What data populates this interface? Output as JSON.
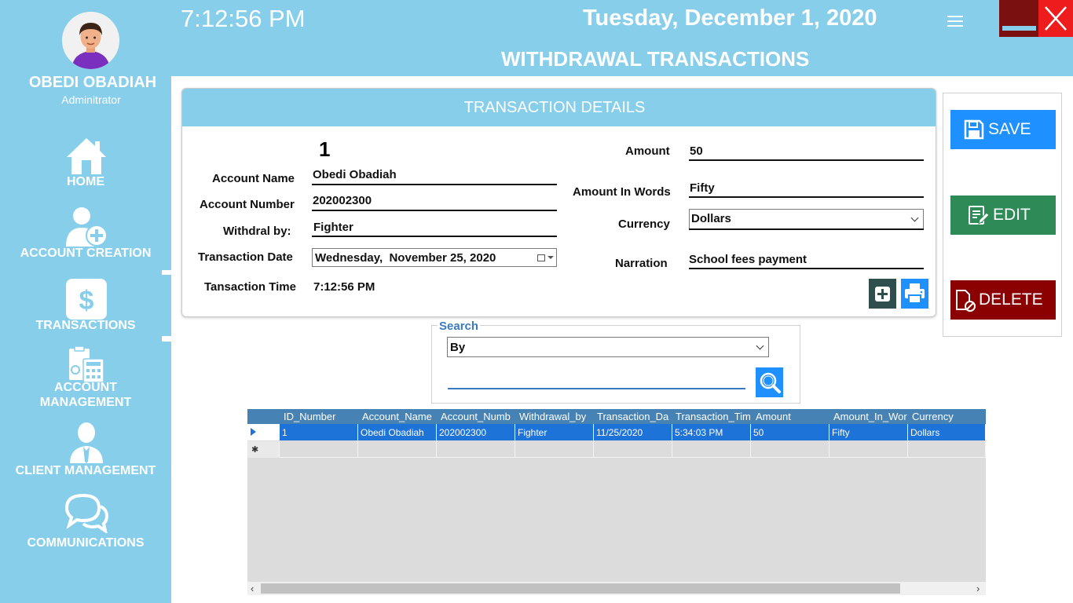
{
  "user": {
    "name": "OBEDI OBADIAH",
    "role": "Admin​itrator"
  },
  "nav": [
    {
      "label": "HOME",
      "icon": "home-icon"
    },
    {
      "label": "ACCOUNT CREATION",
      "icon": "add-user-icon"
    },
    {
      "label": "TRANSACTIONS",
      "icon": "dollar-icon"
    },
    {
      "label": "ACCOUNT MANAGEMENT",
      "label_line1": "ACCOUNT",
      "label_line2": "MANAGEMENT",
      "icon": "calculator-icon"
    },
    {
      "label": "CLIENT MANAGEMENT",
      "icon": "client-icon"
    },
    {
      "label": "COMMUNICATIONS",
      "icon": "chat-icon"
    }
  ],
  "header": {
    "time": "7:12:56 PM",
    "date": "Tuesday, December 1, 2020",
    "page_title": "WITHDRAWAL TRANSACTIONS"
  },
  "details": {
    "title": "TRANSACTION DETAILS",
    "id_number": "1",
    "account_name_label": "Account Name",
    "account_name": "Obedi Obadiah",
    "account_number_label": "Account Number",
    "account_number": "202002300",
    "withdrawn_by_label": "Withdral by:",
    "withdrawn_by": "Fighter",
    "transaction_date_label": "Transaction Date",
    "transaction_date": "Wednesday,  November 25, 2020",
    "transaction_time_label": "Tansaction Time",
    "transaction_time": "7:12:56 PM",
    "amount_label": "Amount",
    "amount": "50",
    "amount_words_label": "Amount In Words",
    "amount_words": "Fifty",
    "currency_label": "Currency",
    "currency": "Dollars",
    "narration_label": "Narration",
    "narration": "School fees payment"
  },
  "actions": {
    "save": "SAVE",
    "edit": "EDIT",
    "delete": "DELETE"
  },
  "search": {
    "legend": "Search",
    "by": "By",
    "query": ""
  },
  "grid": {
    "columns": [
      "ID_Number",
      "Account_Name",
      "Account_Numb",
      "Withdrawal_by",
      "Transaction_Da",
      "Transaction_Tim",
      "Amount",
      "Amount_In_Wor",
      "Currency"
    ],
    "rows": [
      [
        "1",
        "Obedi Obadiah",
        "202002300",
        "Fighter",
        "11/25/2020",
        "5:34:03 PM",
        "50",
        "Fifty",
        "Dollars"
      ]
    ]
  },
  "colors": {
    "sky": "#87CEEB",
    "save": "#1E90FF",
    "edit": "#2E8B57",
    "delete": "#8B0000",
    "grid_header": "#4682B4",
    "selected_row": "#1E73D8"
  }
}
